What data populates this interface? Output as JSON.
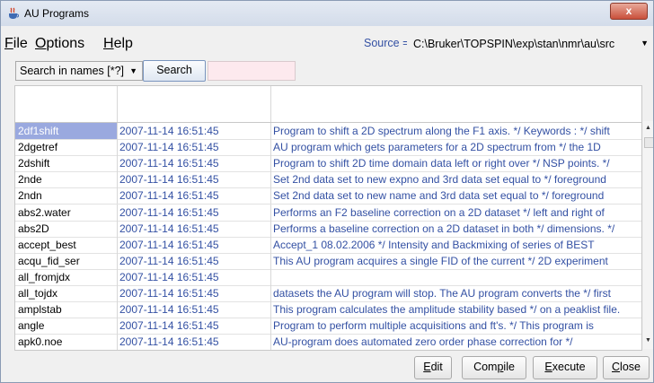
{
  "window": {
    "title": "AU Programs",
    "close_label": "x"
  },
  "menu": {
    "file": {
      "mnemonic": "F",
      "rest": "ile"
    },
    "options": {
      "mnemonic": "O",
      "rest": "ptions"
    },
    "help": {
      "mnemonic": "H",
      "rest": "elp"
    }
  },
  "source": {
    "label": "Source =",
    "value": "C:\\Bruker\\TOPSPIN\\exp\\stan\\nmr\\au\\src"
  },
  "search": {
    "mode_label": "Search in names [*?]",
    "button_label": "Search",
    "input_value": ""
  },
  "table": {
    "rows": [
      {
        "name": "2df1shift",
        "date": "2007-11-14 16:51:45",
        "desc": "Program to shift a 2D spectrum along the F1 axis. */ Keywords : */ shift",
        "selected": true
      },
      {
        "name": "2dgetref",
        "date": "2007-11-14 16:51:45",
        "desc": "AU program which gets parameters for a 2D spectrum from */ the 1D"
      },
      {
        "name": "2dshift",
        "date": "2007-11-14 16:51:45",
        "desc": "Program to shift 2D time domain data left or right over */ NSP points. */"
      },
      {
        "name": "2nde",
        "date": "2007-11-14 16:51:45",
        "desc": "Set 2nd data set to new expno and 3rd data set equal to */ foreground"
      },
      {
        "name": "2ndn",
        "date": "2007-11-14 16:51:45",
        "desc": "Set 2nd data set to new name and 3rd data set equal to */ foreground"
      },
      {
        "name": "abs2.water",
        "date": "2007-11-14 16:51:45",
        "desc": "Performs an F2 baseline correction on a 2D dataset */ left and right of"
      },
      {
        "name": "abs2D",
        "date": "2007-11-14 16:51:45",
        "desc": "Performs a baseline correction on a 2D dataset in both */ dimensions. */"
      },
      {
        "name": "accept_best",
        "date": "2007-11-14 16:51:45",
        "desc": "Accept_1 08.02.2006 */ Intensity and Backmixing of series of BEST"
      },
      {
        "name": "acqu_fid_ser",
        "date": "2007-11-14 16:51:45",
        "desc": "This AU program acquires a single FID of the current */ 2D experiment"
      },
      {
        "name": "all_fromjdx",
        "date": "2007-11-14 16:51:45",
        "desc": ""
      },
      {
        "name": "all_tojdx",
        "date": "2007-11-14 16:51:45",
        "desc": "datasets the AU program will stop. The AU program converts the */ first"
      },
      {
        "name": "amplstab",
        "date": "2007-11-14 16:51:45",
        "desc": "This program calculates the amplitude stability based */ on a peaklist file."
      },
      {
        "name": "angle",
        "date": "2007-11-14 16:51:45",
        "desc": "Program to perform multiple acquisitions and ft's. */ This program is"
      },
      {
        "name": "apk0.noe",
        "date": "2007-11-14 16:51:45",
        "desc": "AU-program does automated zero order phase correction for */"
      }
    ]
  },
  "buttons": {
    "edit": {
      "mnemonic": "E",
      "rest": "dit"
    },
    "compile": {
      "pre": "Com",
      "mnemonic": "p",
      "rest": "ile"
    },
    "execute": {
      "mnemonic": "E",
      "rest": "xecute"
    },
    "close": {
      "mnemonic": "C",
      "rest": "lose"
    }
  },
  "colors": {
    "link_text": "#3350a3",
    "selection": "#9aa9df",
    "search_field": "#fde9ee"
  }
}
